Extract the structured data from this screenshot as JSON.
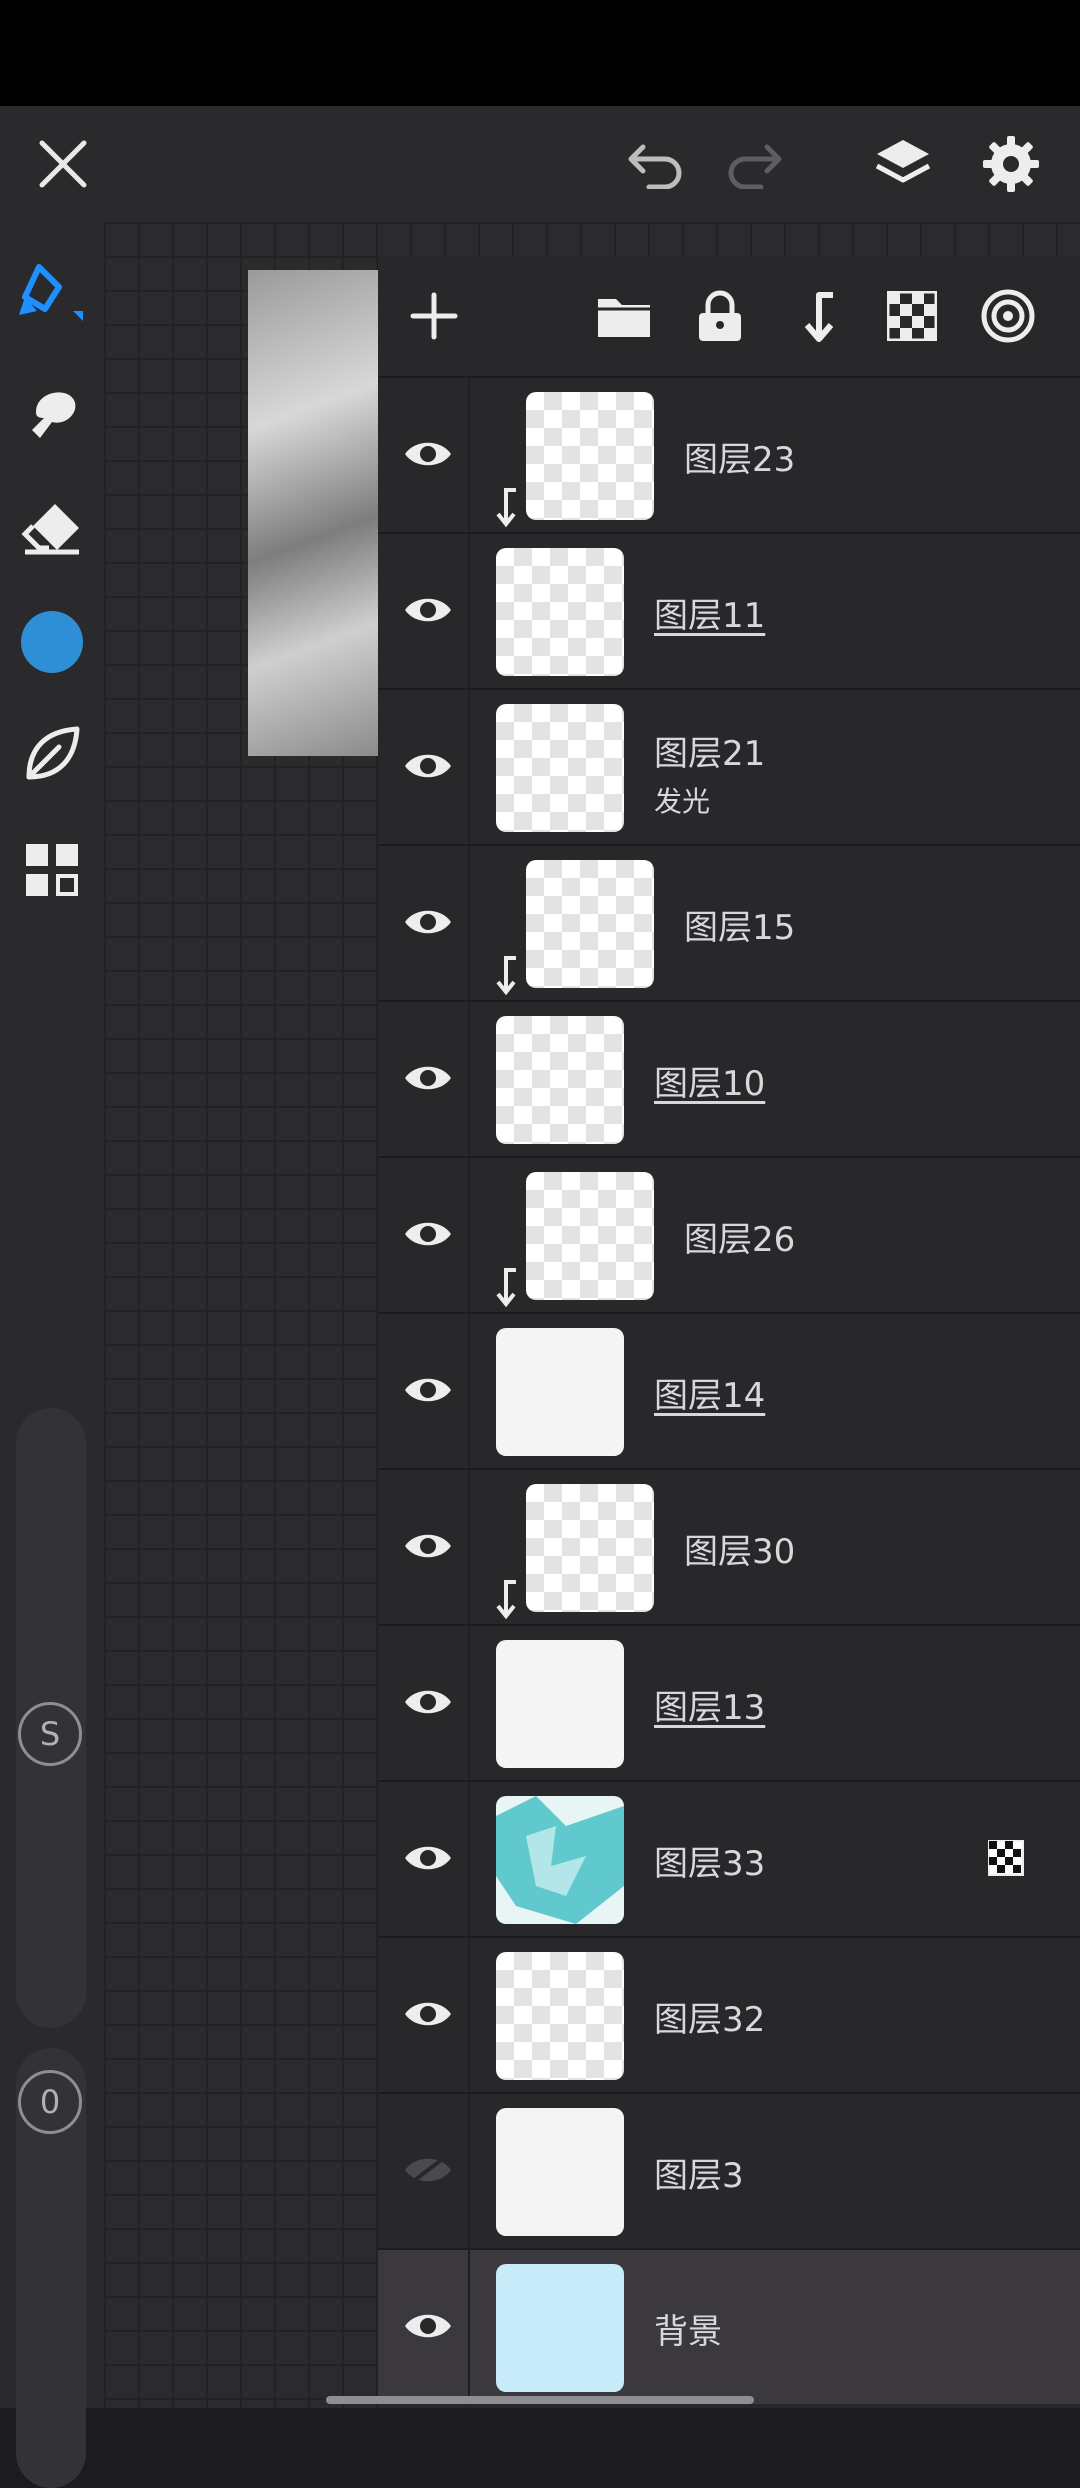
{
  "toolbar": {
    "close_icon": "close-icon",
    "undo_icon": "undo-icon",
    "redo_icon": "redo-icon",
    "layers_icon": "layers-icon",
    "settings_icon": "gear-icon"
  },
  "left_toolbar": {
    "tools": [
      "pen-tool-icon",
      "smudge-icon",
      "eraser-icon",
      "color-swatch",
      "leaf-shape-icon",
      "grid-apps-icon"
    ],
    "active_color": "#2f8fd6",
    "size_slider_label": "S",
    "opacity_slider_label": "0"
  },
  "layer_panel": {
    "tools": [
      "add-layer-icon",
      "folder-icon",
      "lock-icon",
      "clip-arrow-icon",
      "checkerboard-icon",
      "target-icon"
    ],
    "layers": [
      {
        "name": "图层23",
        "clipped": true,
        "underlined": false,
        "visible": true
      },
      {
        "name": "图层11",
        "clipped": false,
        "underlined": true,
        "visible": true
      },
      {
        "name": "图层21",
        "blend": "发光",
        "clipped": false,
        "underlined": false,
        "visible": true
      },
      {
        "name": "图层15",
        "clipped": true,
        "underlined": false,
        "visible": true
      },
      {
        "name": "图层10",
        "clipped": false,
        "underlined": true,
        "visible": true
      },
      {
        "name": "图层26",
        "clipped": true,
        "underlined": false,
        "visible": true
      },
      {
        "name": "图层14",
        "clipped": false,
        "underlined": true,
        "visible": true
      },
      {
        "name": "图层30",
        "clipped": true,
        "underlined": false,
        "visible": true
      },
      {
        "name": "图层13",
        "clipped": false,
        "underlined": true,
        "visible": true
      },
      {
        "name": "图层33",
        "clipped": false,
        "underlined": false,
        "visible": true,
        "alpha_lock": true
      },
      {
        "name": "图层32",
        "clipped": false,
        "underlined": false,
        "visible": true
      },
      {
        "name": "图层3",
        "clipped": false,
        "underlined": false,
        "visible": false
      },
      {
        "name": "背景",
        "clipped": false,
        "underlined": false,
        "visible": true,
        "background": true
      }
    ]
  },
  "colors": {
    "accent_blue": "#1e90ff",
    "background_layer": "#c8ebfa"
  }
}
